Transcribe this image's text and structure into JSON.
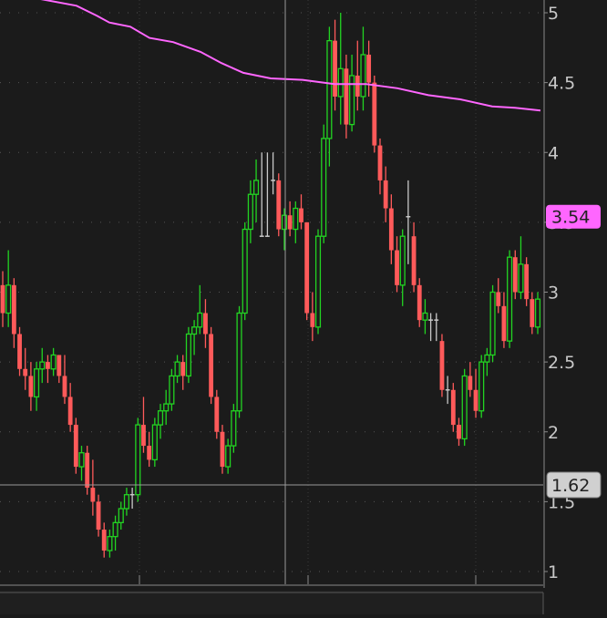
{
  "chart_data": {
    "type": "candlestick",
    "ylim": [
      0.92,
      5.1
    ],
    "y_ticks": [
      "1",
      "1.5",
      "2",
      "2.5",
      "3",
      "3.5",
      "4",
      "4.5",
      "5"
    ],
    "price_badge": {
      "value": "3.54",
      "color": "#ff66ff"
    },
    "crosshair": {
      "y_value": 1.62,
      "label": "1.62"
    },
    "colors": {
      "up": "#22d422",
      "down": "#ff5a5a",
      "doji": "#c8c8c8",
      "moving_average": "#ff66ff",
      "background": "#1b1b1b",
      "grid": "#555555",
      "axis_text": "#c8c8c8"
    },
    "candles": [
      [
        3.05,
        3.15,
        2.75,
        2.85
      ],
      [
        2.85,
        3.3,
        2.75,
        3.05
      ],
      [
        3.05,
        3.1,
        2.6,
        2.7
      ],
      [
        2.7,
        2.75,
        2.4,
        2.45
      ],
      [
        2.45,
        2.6,
        2.3,
        2.4
      ],
      [
        2.4,
        2.5,
        2.15,
        2.25
      ],
      [
        2.25,
        2.5,
        2.15,
        2.45
      ],
      [
        2.45,
        2.6,
        2.35,
        2.5
      ],
      [
        2.5,
        2.55,
        2.35,
        2.45
      ],
      [
        2.45,
        2.6,
        2.4,
        2.55
      ],
      [
        2.55,
        2.55,
        2.35,
        2.4
      ],
      [
        2.4,
        2.55,
        2.2,
        2.25
      ],
      [
        2.25,
        2.35,
        2.0,
        2.05
      ],
      [
        2.05,
        2.1,
        1.7,
        1.75
      ],
      [
        1.75,
        1.9,
        1.65,
        1.85
      ],
      [
        1.85,
        1.9,
        1.55,
        1.6
      ],
      [
        1.6,
        1.8,
        1.4,
        1.5
      ],
      [
        1.5,
        1.55,
        1.25,
        1.3
      ],
      [
        1.3,
        1.35,
        1.1,
        1.15
      ],
      [
        1.15,
        1.3,
        1.1,
        1.25
      ],
      [
        1.25,
        1.4,
        1.15,
        1.35
      ],
      [
        1.35,
        1.5,
        1.3,
        1.45
      ],
      [
        1.45,
        1.6,
        1.4,
        1.55
      ],
      [
        1.55,
        1.6,
        1.45,
        1.55
      ],
      [
        1.55,
        2.1,
        1.5,
        2.05
      ],
      [
        2.05,
        2.25,
        1.85,
        1.9
      ],
      [
        1.9,
        2.0,
        1.75,
        1.8
      ],
      [
        1.8,
        2.1,
        1.75,
        2.05
      ],
      [
        2.05,
        2.2,
        1.95,
        2.15
      ],
      [
        2.15,
        2.3,
        2.05,
        2.2
      ],
      [
        2.2,
        2.45,
        2.15,
        2.4
      ],
      [
        2.4,
        2.55,
        2.35,
        2.5
      ],
      [
        2.5,
        2.55,
        2.3,
        2.4
      ],
      [
        2.4,
        2.75,
        2.35,
        2.7
      ],
      [
        2.7,
        2.8,
        2.55,
        2.75
      ],
      [
        2.75,
        3.05,
        2.7,
        2.85
      ],
      [
        2.85,
        2.95,
        2.6,
        2.7
      ],
      [
        2.7,
        2.75,
        2.2,
        2.25
      ],
      [
        2.25,
        2.3,
        1.95,
        2.0
      ],
      [
        2.0,
        2.05,
        1.7,
        1.75
      ],
      [
        1.75,
        1.95,
        1.7,
        1.9
      ],
      [
        1.9,
        2.2,
        1.85,
        2.15
      ],
      [
        2.15,
        2.9,
        2.1,
        2.85
      ],
      [
        2.85,
        3.5,
        2.8,
        3.45
      ],
      [
        3.45,
        3.8,
        3.35,
        3.7
      ],
      [
        3.7,
        3.95,
        3.5,
        3.8
      ],
      [
        3.4,
        4.0,
        3.4,
        3.4
      ],
      [
        3.4,
        4.0,
        3.4,
        3.4
      ],
      [
        3.8,
        4.0,
        3.7,
        3.8
      ],
      [
        3.8,
        3.85,
        3.4,
        3.45
      ],
      [
        3.45,
        3.6,
        3.3,
        3.55
      ],
      [
        3.55,
        3.65,
        3.4,
        3.45
      ],
      [
        3.45,
        3.65,
        3.35,
        3.6
      ],
      [
        3.6,
        3.7,
        3.45,
        3.5
      ],
      [
        3.5,
        3.5,
        2.8,
        2.85
      ],
      [
        2.85,
        3.0,
        2.65,
        2.75
      ],
      [
        2.75,
        3.45,
        2.7,
        3.4
      ],
      [
        3.4,
        4.2,
        3.35,
        4.1
      ],
      [
        4.1,
        4.9,
        3.9,
        4.8
      ],
      [
        4.8,
        4.95,
        4.3,
        4.4
      ],
      [
        4.4,
        5.0,
        4.2,
        4.6
      ],
      [
        4.6,
        4.7,
        4.1,
        4.2
      ],
      [
        4.2,
        4.7,
        4.15,
        4.55
      ],
      [
        4.55,
        4.8,
        4.3,
        4.4
      ],
      [
        4.4,
        4.9,
        4.3,
        4.7
      ],
      [
        4.7,
        4.8,
        4.4,
        4.5
      ],
      [
        4.5,
        4.55,
        4.0,
        4.05
      ],
      [
        4.05,
        4.1,
        3.7,
        3.8
      ],
      [
        3.8,
        3.9,
        3.5,
        3.6
      ],
      [
        3.6,
        3.7,
        3.2,
        3.3
      ],
      [
        3.3,
        3.4,
        3.0,
        3.05
      ],
      [
        3.05,
        3.45,
        2.9,
        3.4
      ],
      [
        3.54,
        3.8,
        3.2,
        3.54
      ],
      [
        3.4,
        3.5,
        3.0,
        3.05
      ],
      [
        3.05,
        3.1,
        2.75,
        2.8
      ],
      [
        2.8,
        2.95,
        2.7,
        2.85
      ],
      [
        2.8,
        2.85,
        2.65,
        2.8
      ],
      [
        2.8,
        2.85,
        2.65,
        2.8
      ],
      [
        2.65,
        2.7,
        2.25,
        2.3
      ],
      [
        2.3,
        2.4,
        2.2,
        2.3
      ],
      [
        2.3,
        2.35,
        2.0,
        2.05
      ],
      [
        2.05,
        2.1,
        1.9,
        1.95
      ],
      [
        1.95,
        2.45,
        1.9,
        2.4
      ],
      [
        2.4,
        2.5,
        2.25,
        2.3
      ],
      [
        2.3,
        2.45,
        2.1,
        2.15
      ],
      [
        2.15,
        2.55,
        2.1,
        2.5
      ],
      [
        2.5,
        2.6,
        2.4,
        2.55
      ],
      [
        2.55,
        3.05,
        2.5,
        3.0
      ],
      [
        3.0,
        3.1,
        2.85,
        2.9
      ],
      [
        2.9,
        3.0,
        2.6,
        2.65
      ],
      [
        2.65,
        3.3,
        2.6,
        3.25
      ],
      [
        3.25,
        3.3,
        2.95,
        3.0
      ],
      [
        3.0,
        3.4,
        2.95,
        3.2
      ],
      [
        3.2,
        3.25,
        2.9,
        2.95
      ],
      [
        2.95,
        3.0,
        2.7,
        2.75
      ],
      [
        2.75,
        3.0,
        2.7,
        2.95
      ]
    ],
    "moving_average": [
      [
        43,
        5.1
      ],
      [
        84,
        5.05
      ],
      [
        106,
        4.98
      ],
      [
        120,
        4.93
      ],
      [
        143,
        4.9
      ],
      [
        164,
        4.82
      ],
      [
        190,
        4.79
      ],
      [
        220,
        4.72
      ],
      [
        243,
        4.64
      ],
      [
        267,
        4.57
      ],
      [
        297,
        4.53
      ],
      [
        332,
        4.52
      ],
      [
        367,
        4.49
      ],
      [
        402,
        4.49
      ],
      [
        436,
        4.46
      ],
      [
        470,
        4.41
      ],
      [
        505,
        4.38
      ],
      [
        540,
        4.33
      ],
      [
        565,
        4.32
      ],
      [
        593,
        4.3
      ]
    ]
  }
}
